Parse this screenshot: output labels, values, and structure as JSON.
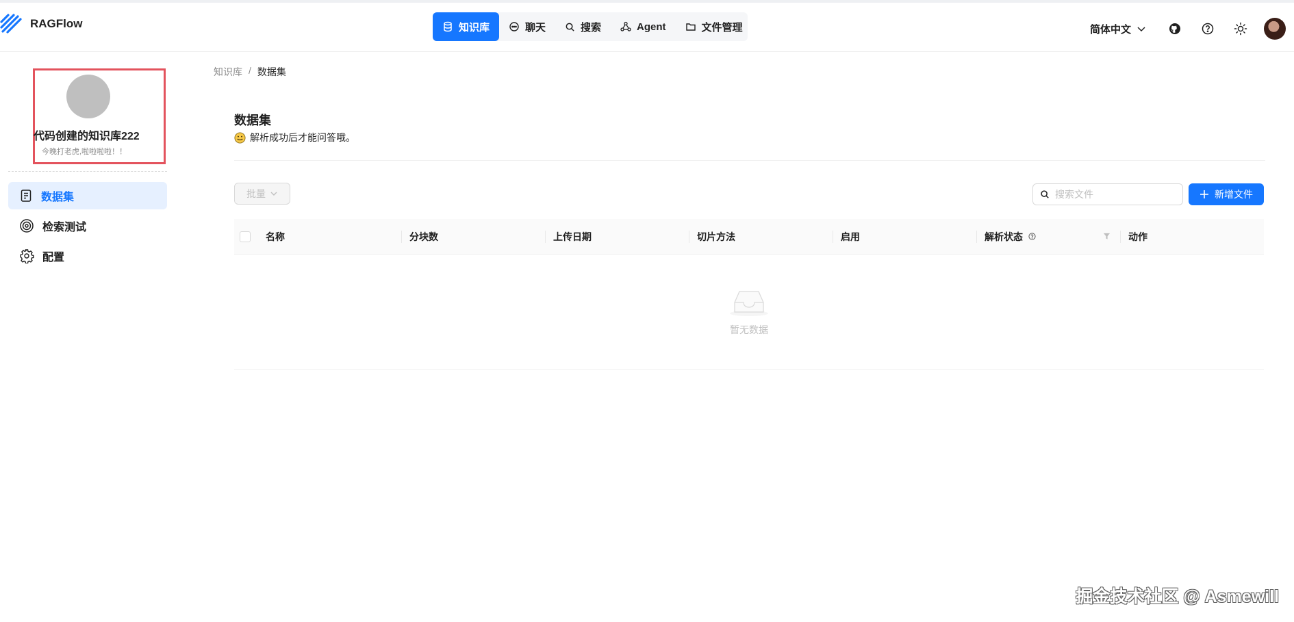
{
  "app": {
    "name": "RAGFlow"
  },
  "nav": [
    {
      "label": "知识库",
      "icon": "database-icon",
      "active": true
    },
    {
      "label": "聊天",
      "icon": "chat-icon",
      "active": false
    },
    {
      "label": "搜索",
      "icon": "search-icon",
      "active": false
    },
    {
      "label": "Agent",
      "icon": "agent-icon",
      "active": false
    },
    {
      "label": "文件管理",
      "icon": "folder-icon",
      "active": false
    }
  ],
  "header": {
    "language": "简体中文"
  },
  "sidebar": {
    "kb_name": "代码创建的知识库222",
    "kb_description": "今晚打老虎,啦啦啦啦！！",
    "items": [
      {
        "label": "数据集",
        "icon": "document-icon",
        "active": true
      },
      {
        "label": "检索测试",
        "icon": "target-icon",
        "active": false
      },
      {
        "label": "配置",
        "icon": "gear-icon",
        "active": false
      }
    ]
  },
  "breadcrumb": {
    "parent": "知识库",
    "separator": "/",
    "current": "数据集"
  },
  "page": {
    "title": "数据集",
    "subtitle": "解析成功后才能问答哦。",
    "batch_label": "批量",
    "search_placeholder": "搜索文件",
    "add_label": "新增文件"
  },
  "table": {
    "columns": [
      "名称",
      "分块数",
      "上传日期",
      "切片方法",
      "启用",
      "解析状态",
      "动作"
    ],
    "rows": [],
    "empty_text": "暂无数据"
  },
  "watermark": "掘金技术社区 @ Asmewill",
  "colors": {
    "primary": "#1677ff",
    "active_bg": "#e6f0ff",
    "highlight_border": "#e3535d"
  }
}
